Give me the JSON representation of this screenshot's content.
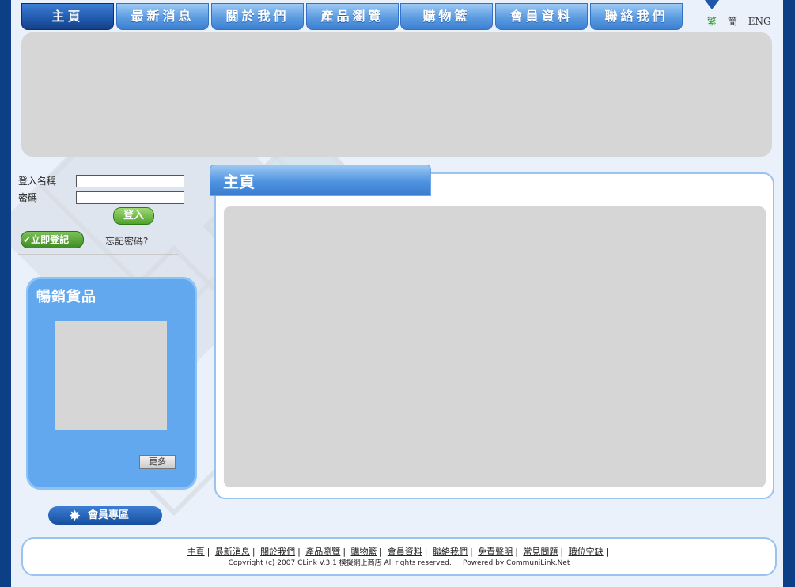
{
  "nav": {
    "tabs": [
      {
        "label": "主頁",
        "active": true
      },
      {
        "label": "最新消息"
      },
      {
        "label": "關於我們"
      },
      {
        "label": "產品瀏覽"
      },
      {
        "label": "購物籃"
      },
      {
        "label": "會員資料"
      },
      {
        "label": "聯絡我們"
      }
    ],
    "languages": [
      "繁",
      "簡",
      "ENG"
    ]
  },
  "login": {
    "username_label": "登入名稱",
    "password_label": "密碼",
    "login_button": "登入",
    "register_button": "立即登記",
    "forgot_link": "忘記密碼?"
  },
  "best_sellers": {
    "title": "暢銷貨品",
    "more_button": "更多"
  },
  "member_zone": {
    "label": "會員專區"
  },
  "main": {
    "title": "主頁"
  },
  "footer": {
    "links": [
      "主頁",
      "最新消息",
      "關於我們",
      "產品瀏覽",
      "購物籃",
      "會員資料",
      "聯絡我們",
      "免責聲明",
      "常見問題",
      "職位空缺"
    ],
    "copyright_prefix": "Copyright (c) 2007",
    "product_link": "CLink V.3.1 模擬網上商店",
    "rights": "All rights reserved.",
    "powered_by": "Powered by",
    "powered_link": "CommuniLink.Net"
  },
  "colors": {
    "outer": "#0d3f86",
    "page": "#eaf1fb",
    "tab": "#5a9be0",
    "tab_active": "#1f58ab",
    "panel": "#62a8ef",
    "placeholder": "#d6d6d6"
  }
}
